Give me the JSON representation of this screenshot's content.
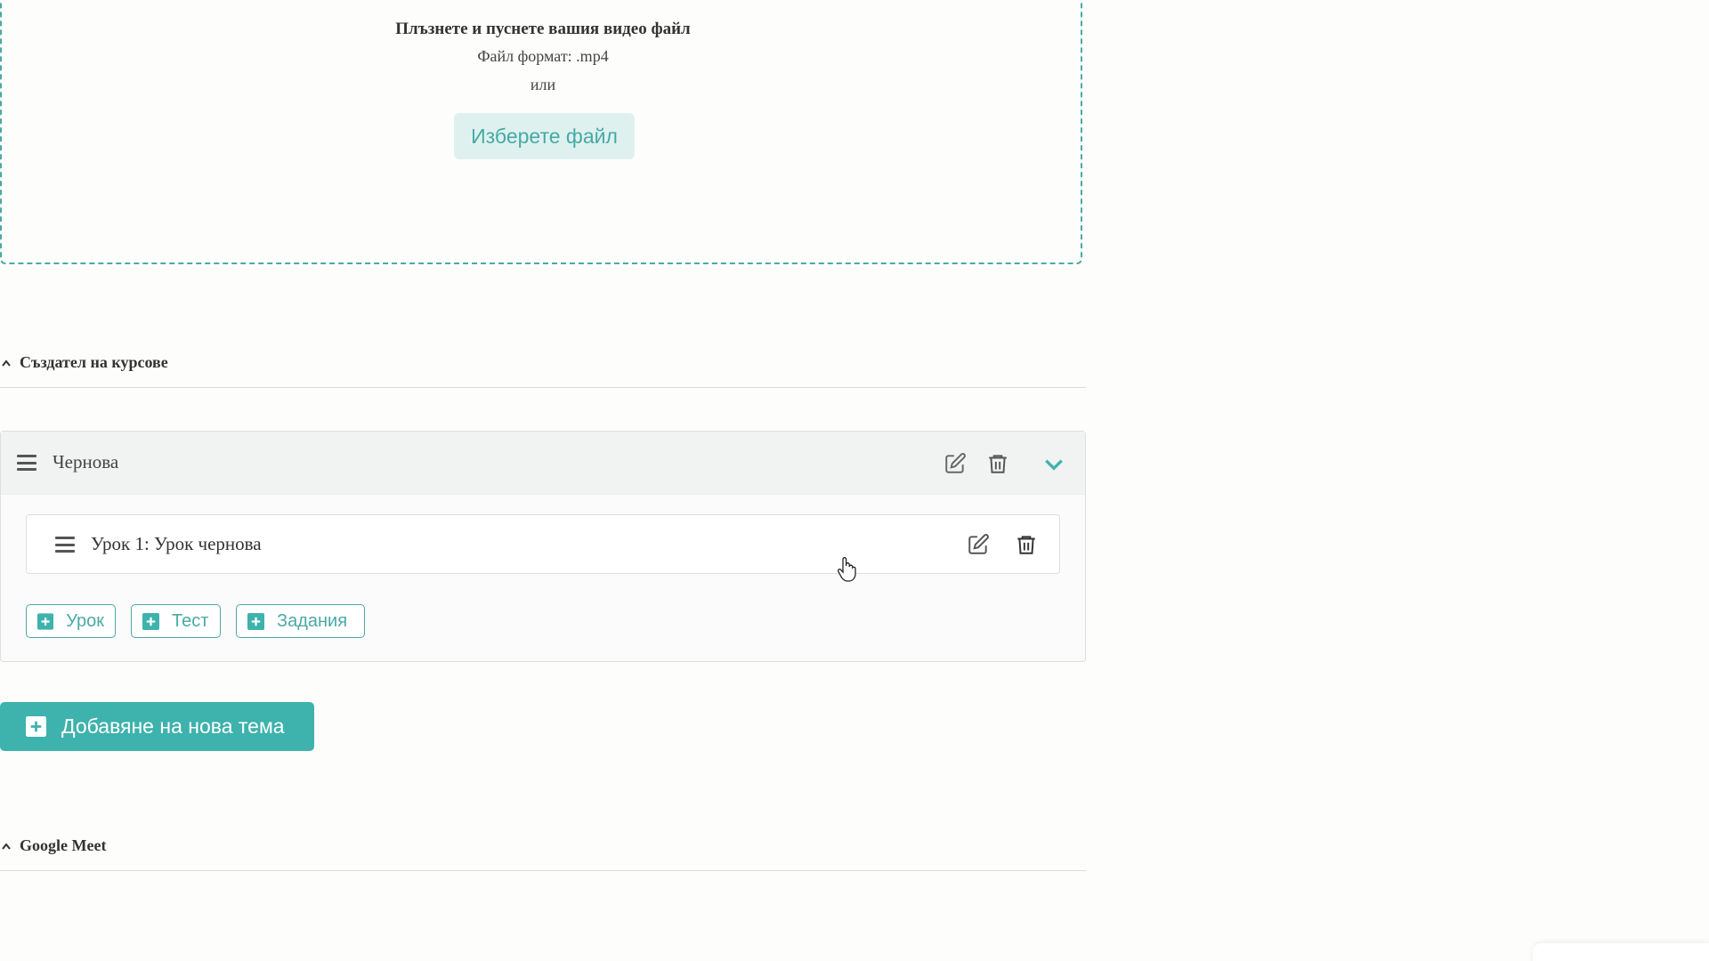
{
  "upload": {
    "title": "Плъзнете и пуснете вашия видео файл",
    "format": "Файл формат: .mp4",
    "or": "или",
    "choose_button": "Изберете файл"
  },
  "sections": {
    "course_builder": "Създател на курсове",
    "google_meet": "Google Meet"
  },
  "topic": {
    "title": "Чернова",
    "lessons": [
      {
        "title": "Урок 1: Урок чернова"
      }
    ],
    "buttons": {
      "lesson": "Урок",
      "test": "Тест",
      "tasks": "Задания"
    }
  },
  "add_topic_button": "Добавяне на нова тема",
  "colors": {
    "accent": "#3eb2ad",
    "accent_light": "#dff1ef",
    "border": "#dcdfde"
  },
  "icons": [
    "hamburger-icon",
    "edit-icon",
    "trash-icon",
    "chevron-down-icon",
    "plus-square-icon",
    "caret-up-icon",
    "pointer-cursor"
  ]
}
